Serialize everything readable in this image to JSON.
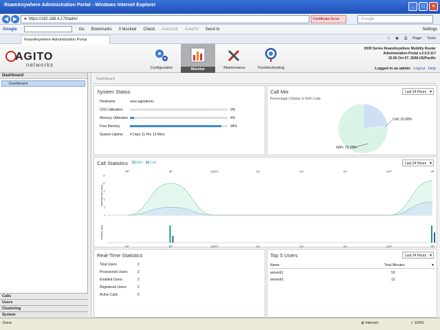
{
  "browser": {
    "title": "RoamAnywhere Administration Portal - Windows Internet Explorer",
    "url": "https://192.168.4.170/adm/",
    "cert_error": "Certificate Error",
    "search_placeholder": "Google",
    "toolbar_label": "Google",
    "go": "Go",
    "bookmarks": "Bookmarks",
    "blocked": "0 blocked",
    "check": "Check",
    "autolink": "AutoLink",
    "autofill": "AutoFill",
    "sendto": "Send to",
    "settings": "Settings",
    "tab": "RoamAnywhere Administration Portal",
    "page_menu": "Page",
    "tools_menu": "Tools"
  },
  "header": {
    "logo_word": "AGITO",
    "logo_sub": "networks",
    "nav": [
      {
        "label": "Configuration",
        "icon": "gears-icon"
      },
      {
        "label": "Monitor",
        "icon": "bar-chart-icon"
      },
      {
        "label": "Maintenance",
        "icon": "tools-icon"
      },
      {
        "label": "Troubleshooting",
        "icon": "stethoscope-icon"
      }
    ],
    "product_line1": "2000 Series RoamAnywhere Mobility Router",
    "product_line2": "Administration Portal v.2.0.0.117",
    "product_line3": "15:50 Oct 07, 2008 US/Pacific",
    "logged_in": "Logged in as admin",
    "logout": "Logout",
    "help": "Help"
  },
  "sidebar": {
    "header": "Dashboard",
    "item": "Dashboard",
    "sections": [
      "Calls",
      "Users",
      "Clustering",
      "System"
    ]
  },
  "breadcrumb": "Dashboard",
  "system_status": {
    "title": "System Status",
    "rows": [
      {
        "label": "Hostname",
        "value": "rane-agitodemo"
      },
      {
        "label": "CPU Utilization",
        "value": "0%",
        "level": 0
      },
      {
        "label": "Memory Utilization",
        "value": "4%",
        "level": 4
      },
      {
        "label": "Free Memory",
        "value": "94%",
        "level": 94
      },
      {
        "label": "System Uptime",
        "value": "4 Days 11 Hrs 13 Mins"
      }
    ]
  },
  "call_mix": {
    "title": "Call Mix",
    "subtitle": "Percentage Cellular to WiFi Calls",
    "dropdown": "Last 24 Hours",
    "cell_label": "Cell: 23.08%",
    "wifi_label": "WiFi: 76.92%"
  },
  "call_statistics": {
    "title": "Call Statistics",
    "legend_wifi": "WiFi",
    "legend_cell": "Cell",
    "dropdown": "Last 24 Hours",
    "y1_label": "Total Call Minutes",
    "y2_label": "Call Volume",
    "top_ticks": [
      "6P",
      "9P",
      "10/07",
      "3A",
      "6A",
      "9A",
      "12P",
      "3P"
    ],
    "bottom_ticks": [
      "6P",
      "9P",
      "10/07",
      "3A",
      "6A",
      "9A",
      "12P",
      "3P"
    ]
  },
  "chart_data": [
    {
      "type": "area",
      "title": "Call Statistics",
      "ylabel": "Total Call Minutes",
      "x": [
        "6P",
        "9P",
        "10/07",
        "3A",
        "6A",
        "9A",
        "12P",
        "3P"
      ],
      "ylim": [
        0,
        15
      ],
      "series": [
        {
          "name": "WiFi",
          "values": [
            0,
            12,
            0,
            0,
            0,
            0,
            0,
            13
          ]
        },
        {
          "name": "Cell",
          "values": [
            0,
            3,
            0,
            0,
            0,
            0,
            0,
            5
          ]
        }
      ]
    },
    {
      "type": "bar",
      "ylabel": "Call Volume",
      "x": [
        "6P",
        "9P",
        "10/07",
        "3A",
        "6A",
        "9A",
        "12P",
        "3P"
      ],
      "series": [
        {
          "name": "WiFi",
          "values": [
            0,
            5,
            0,
            0,
            0,
            0,
            0,
            5
          ]
        },
        {
          "name": "Cell",
          "values": [
            0,
            2,
            0,
            0,
            0,
            0,
            0,
            3
          ]
        }
      ]
    },
    {
      "type": "pie",
      "title": "Call Mix",
      "categories": [
        "Cell",
        "WiFi"
      ],
      "values": [
        23.08,
        76.92
      ],
      "colors": [
        "#cfe0f5",
        "#d9f3e6"
      ]
    }
  ],
  "realtime": {
    "title": "Real-Time Statistics",
    "rows": [
      {
        "label": "Total Users",
        "value": "2"
      },
      {
        "label": "Provisioned Users",
        "value": "2"
      },
      {
        "label": "Enabled Users",
        "value": "2"
      },
      {
        "label": "Registered Users",
        "value": "2"
      },
      {
        "label": "Active Calls",
        "value": "0"
      }
    ]
  },
  "top_users": {
    "title": "Top 5 Users",
    "dropdown": "Last 24 Hours",
    "col_name": "Name",
    "col_minutes": "Total Minutes",
    "rows": [
      {
        "name": "annesh1",
        "minutes": "53"
      },
      {
        "name": "annesh2",
        "minutes": "12"
      }
    ]
  },
  "statusbar": {
    "left": "Done",
    "zone": "Internet",
    "zoom": "100%"
  }
}
